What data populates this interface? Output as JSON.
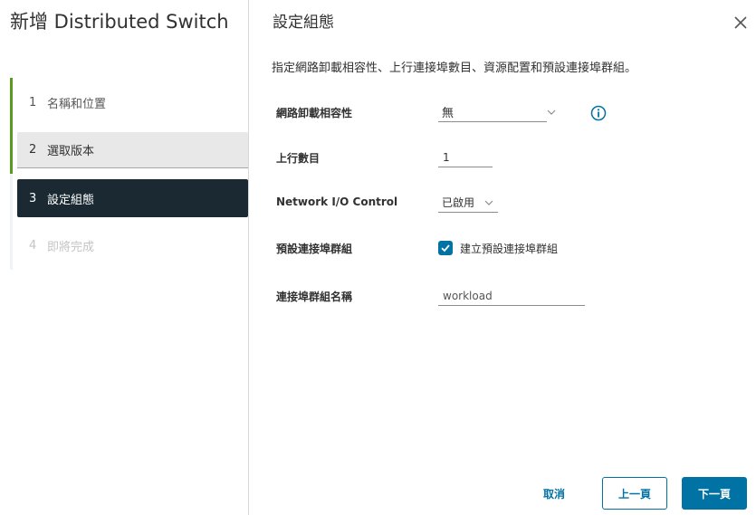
{
  "wizard": {
    "title": "新增 Distributed Switch",
    "steps": [
      {
        "number": "1",
        "label": "名稱和位置",
        "state": "completed"
      },
      {
        "number": "2",
        "label": "選取版本",
        "state": "completed"
      },
      {
        "number": "3",
        "label": "設定組態",
        "state": "active"
      },
      {
        "number": "4",
        "label": "即將完成",
        "state": "disabled"
      }
    ]
  },
  "page": {
    "title": "設定組態",
    "description": "指定網路卸載相容性、上行連接埠數目、資源配置和預設連接埠群組。"
  },
  "form": {
    "offload_compat": {
      "label": "網路卸載相容性",
      "value": "無"
    },
    "uplinks": {
      "label": "上行數目",
      "value": "1"
    },
    "nioc": {
      "label": "Network I/O Control",
      "value": "已啟用"
    },
    "default_portgroup": {
      "label": "預設連接埠群組",
      "checkbox_label": "建立預設連接埠群組",
      "checked": true
    },
    "portgroup_name": {
      "label": "連接埠群組名稱",
      "value": "workload"
    }
  },
  "footer": {
    "cancel_label": "取消",
    "back_label": "上一頁",
    "next_label": "下一頁"
  },
  "colors": {
    "accent": "#0072a3",
    "progress": "#5a9a1f",
    "active_step_bg": "#1b2a32"
  },
  "icons": {
    "close": "close-icon",
    "info": "info-icon",
    "chevron": "chevron-down-icon",
    "check": "check-icon"
  }
}
